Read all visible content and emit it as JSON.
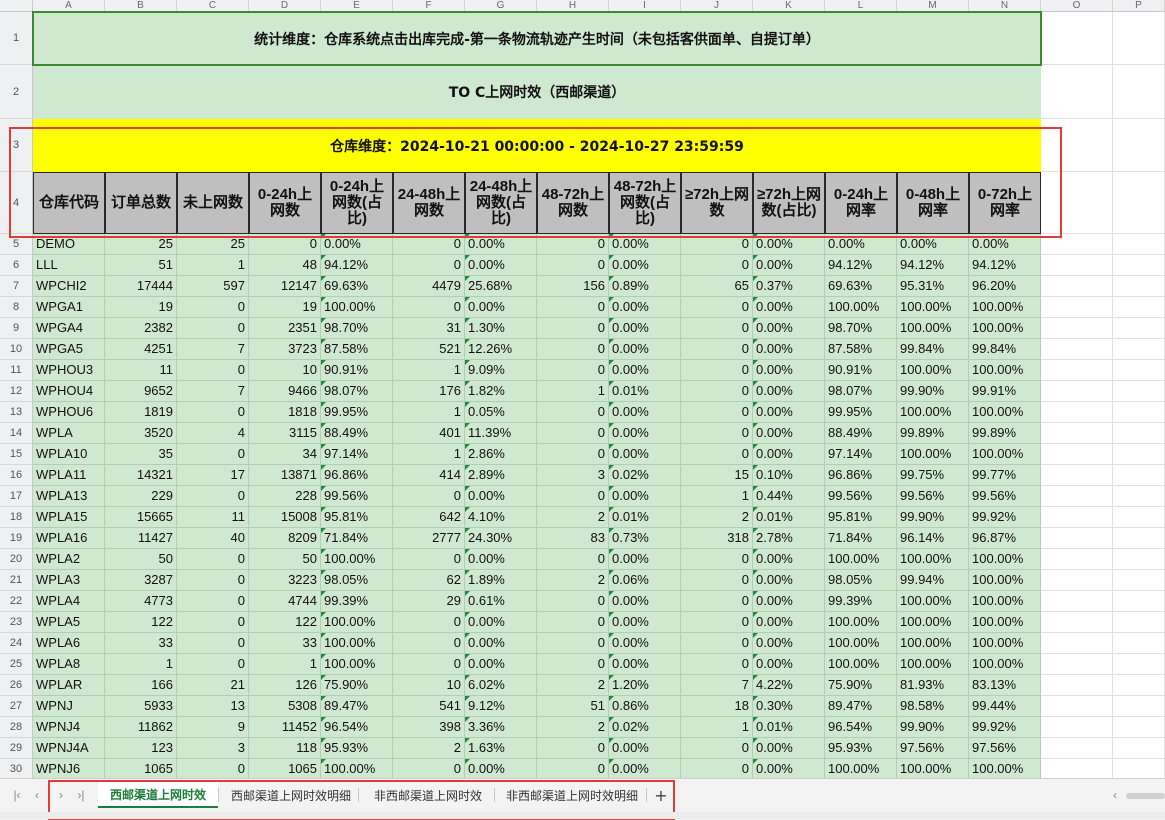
{
  "columns": [
    "A",
    "B",
    "C",
    "D",
    "E",
    "F",
    "G",
    "H",
    "I",
    "J",
    "K",
    "L",
    "M",
    "N",
    "O",
    "P"
  ],
  "row_numbers": [
    "1",
    "2",
    "3",
    "4",
    "5",
    "6",
    "7",
    "8",
    "9",
    "10",
    "11",
    "12",
    "13",
    "14",
    "15",
    "16",
    "17",
    "18",
    "19",
    "20",
    "21",
    "22",
    "23",
    "24",
    "25",
    "26",
    "27",
    "28",
    "29",
    "30"
  ],
  "title_row1": "统计维度：仓库系统点击出库完成-第一条物流轨迹产生时间（未包括客供面单、自提订单）",
  "title_row2": "TO C上网时效（西邮渠道）",
  "title_row3": "仓库维度：2024-10-21 00:00:00 - 2024-10-27 23:59:59",
  "headers": [
    "仓库代码",
    "订单总数",
    "未上网数",
    "0-24h上网数",
    "0-24h上网数(占比)",
    "24-48h上网数",
    "24-48h上网数(占比)",
    "48-72h上网数",
    "48-72h上网数(占比)",
    "≥72h上网数",
    "≥72h上网数(占比)",
    "0-24h上网率",
    "0-48h上网率",
    "0-72h上网率"
  ],
  "rows": [
    [
      "DEMO",
      "25",
      "25",
      "0",
      "0.00%",
      "0",
      "0.00%",
      "0",
      "0.00%",
      "0",
      "0.00%",
      "0.00%",
      "0.00%",
      "0.00%"
    ],
    [
      "LLL",
      "51",
      "1",
      "48",
      "94.12%",
      "0",
      "0.00%",
      "0",
      "0.00%",
      "0",
      "0.00%",
      "94.12%",
      "94.12%",
      "94.12%"
    ],
    [
      "WPCHI2",
      "17444",
      "597",
      "12147",
      "69.63%",
      "4479",
      "25.68%",
      "156",
      "0.89%",
      "65",
      "0.37%",
      "69.63%",
      "95.31%",
      "96.20%"
    ],
    [
      "WPGA1",
      "19",
      "0",
      "19",
      "100.00%",
      "0",
      "0.00%",
      "0",
      "0.00%",
      "0",
      "0.00%",
      "100.00%",
      "100.00%",
      "100.00%"
    ],
    [
      "WPGA4",
      "2382",
      "0",
      "2351",
      "98.70%",
      "31",
      "1.30%",
      "0",
      "0.00%",
      "0",
      "0.00%",
      "98.70%",
      "100.00%",
      "100.00%"
    ],
    [
      "WPGA5",
      "4251",
      "7",
      "3723",
      "87.58%",
      "521",
      "12.26%",
      "0",
      "0.00%",
      "0",
      "0.00%",
      "87.58%",
      "99.84%",
      "99.84%"
    ],
    [
      "WPHOU3",
      "11",
      "0",
      "10",
      "90.91%",
      "1",
      "9.09%",
      "0",
      "0.00%",
      "0",
      "0.00%",
      "90.91%",
      "100.00%",
      "100.00%"
    ],
    [
      "WPHOU4",
      "9652",
      "7",
      "9466",
      "98.07%",
      "176",
      "1.82%",
      "1",
      "0.01%",
      "0",
      "0.00%",
      "98.07%",
      "99.90%",
      "99.91%"
    ],
    [
      "WPHOU6",
      "1819",
      "0",
      "1818",
      "99.95%",
      "1",
      "0.05%",
      "0",
      "0.00%",
      "0",
      "0.00%",
      "99.95%",
      "100.00%",
      "100.00%"
    ],
    [
      "WPLA",
      "3520",
      "4",
      "3115",
      "88.49%",
      "401",
      "11.39%",
      "0",
      "0.00%",
      "0",
      "0.00%",
      "88.49%",
      "99.89%",
      "99.89%"
    ],
    [
      "WPLA10",
      "35",
      "0",
      "34",
      "97.14%",
      "1",
      "2.86%",
      "0",
      "0.00%",
      "0",
      "0.00%",
      "97.14%",
      "100.00%",
      "100.00%"
    ],
    [
      "WPLA11",
      "14321",
      "17",
      "13871",
      "96.86%",
      "414",
      "2.89%",
      "3",
      "0.02%",
      "15",
      "0.10%",
      "96.86%",
      "99.75%",
      "99.77%"
    ],
    [
      "WPLA13",
      "229",
      "0",
      "228",
      "99.56%",
      "0",
      "0.00%",
      "0",
      "0.00%",
      "1",
      "0.44%",
      "99.56%",
      "99.56%",
      "99.56%"
    ],
    [
      "WPLA15",
      "15665",
      "11",
      "15008",
      "95.81%",
      "642",
      "4.10%",
      "2",
      "0.01%",
      "2",
      "0.01%",
      "95.81%",
      "99.90%",
      "99.92%"
    ],
    [
      "WPLA16",
      "11427",
      "40",
      "8209",
      "71.84%",
      "2777",
      "24.30%",
      "83",
      "0.73%",
      "318",
      "2.78%",
      "71.84%",
      "96.14%",
      "96.87%"
    ],
    [
      "WPLA2",
      "50",
      "0",
      "50",
      "100.00%",
      "0",
      "0.00%",
      "0",
      "0.00%",
      "0",
      "0.00%",
      "100.00%",
      "100.00%",
      "100.00%"
    ],
    [
      "WPLA3",
      "3287",
      "0",
      "3223",
      "98.05%",
      "62",
      "1.89%",
      "2",
      "0.06%",
      "0",
      "0.00%",
      "98.05%",
      "99.94%",
      "100.00%"
    ],
    [
      "WPLA4",
      "4773",
      "0",
      "4744",
      "99.39%",
      "29",
      "0.61%",
      "0",
      "0.00%",
      "0",
      "0.00%",
      "99.39%",
      "100.00%",
      "100.00%"
    ],
    [
      "WPLA5",
      "122",
      "0",
      "122",
      "100.00%",
      "0",
      "0.00%",
      "0",
      "0.00%",
      "0",
      "0.00%",
      "100.00%",
      "100.00%",
      "100.00%"
    ],
    [
      "WPLA6",
      "33",
      "0",
      "33",
      "100.00%",
      "0",
      "0.00%",
      "0",
      "0.00%",
      "0",
      "0.00%",
      "100.00%",
      "100.00%",
      "100.00%"
    ],
    [
      "WPLA8",
      "1",
      "0",
      "1",
      "100.00%",
      "0",
      "0.00%",
      "0",
      "0.00%",
      "0",
      "0.00%",
      "100.00%",
      "100.00%",
      "100.00%"
    ],
    [
      "WPLAR",
      "166",
      "21",
      "126",
      "75.90%",
      "10",
      "6.02%",
      "2",
      "1.20%",
      "7",
      "4.22%",
      "75.90%",
      "81.93%",
      "83.13%"
    ],
    [
      "WPNJ",
      "5933",
      "13",
      "5308",
      "89.47%",
      "541",
      "9.12%",
      "51",
      "0.86%",
      "18",
      "0.30%",
      "89.47%",
      "98.58%",
      "99.44%"
    ],
    [
      "WPNJ4",
      "11862",
      "9",
      "11452",
      "96.54%",
      "398",
      "3.36%",
      "2",
      "0.02%",
      "1",
      "0.01%",
      "96.54%",
      "99.90%",
      "99.92%"
    ],
    [
      "WPNJ4A",
      "123",
      "3",
      "118",
      "95.93%",
      "2",
      "1.63%",
      "0",
      "0.00%",
      "0",
      "0.00%",
      "95.93%",
      "97.56%",
      "97.56%"
    ],
    [
      "WPNJ6",
      "1065",
      "0",
      "1065",
      "100.00%",
      "0",
      "0.00%",
      "0",
      "0.00%",
      "0",
      "0.00%",
      "100.00%",
      "100.00%",
      "100.00%"
    ]
  ],
  "sheet_tabs": [
    "西邮渠道上网时效",
    "西邮渠道上网时效明细",
    "非西邮渠道上网时效",
    "非西邮渠道上网时效明细"
  ],
  "add_sheet_label": "+",
  "colors": {
    "table_green": "#cfe8d0",
    "title_yellow": "#ffff00",
    "header_gray": "#bfbfbf",
    "annotation_red": "#e23b3b",
    "active_tab_green": "#1e7d3a"
  }
}
